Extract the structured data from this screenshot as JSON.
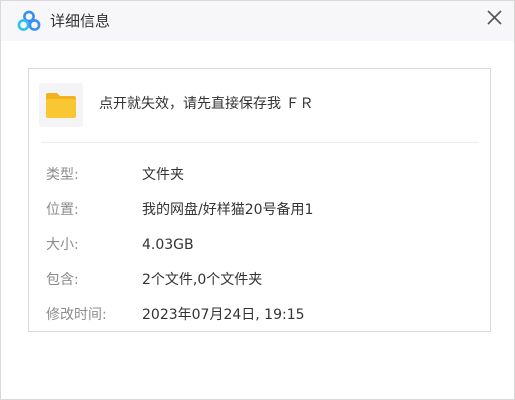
{
  "window": {
    "title": "详细信息",
    "logo_icon": "baidu-netdisk-logo-icon",
    "close_icon": "close-icon"
  },
  "file": {
    "icon": "folder-icon",
    "name": "点开就失效，请先直接保存我 ＦＲ"
  },
  "details": [
    {
      "label": "类型:",
      "value": "文件夹"
    },
    {
      "label": "位置:",
      "value": "我的网盘/好样猫20号备用1"
    },
    {
      "label": "大小:",
      "value": "4.03GB"
    },
    {
      "label": "包含:",
      "value": "2个文件,0个文件夹"
    },
    {
      "label": "修改时间:",
      "value": "2023年07月24日, 19:15"
    }
  ],
  "colors": {
    "logo_blue": "#3b8ef0",
    "logo_cyan": "#27c1f2",
    "folder_yellow": "#f8c733",
    "folder_tab": "#f3b21c",
    "label_gray": "#8c8c8c",
    "text_dark": "#333333",
    "border": "#d9d9d9"
  }
}
